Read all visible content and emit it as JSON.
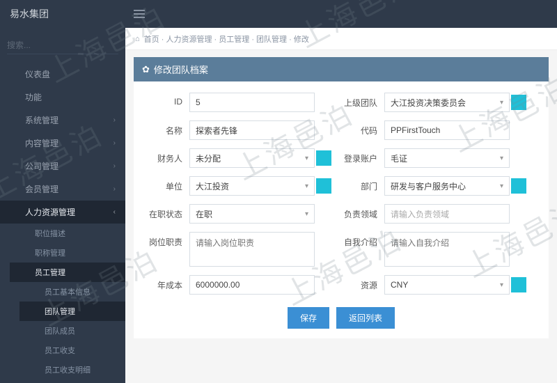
{
  "brand": "易水集团",
  "search_placeholder": "搜索...",
  "sidebar": [
    {
      "label": "仪表盘",
      "icon": "home"
    },
    {
      "label": "功能",
      "icon": "globe"
    },
    {
      "label": "系统管理",
      "icon": "sliders",
      "chev": true
    },
    {
      "label": "内容管理",
      "icon": "layers",
      "chev": true
    },
    {
      "label": "公司管理",
      "icon": "building",
      "chev": true
    },
    {
      "label": "会员管理",
      "icon": "trophy",
      "chev": true
    },
    {
      "label": "人力资源管理",
      "icon": "users",
      "chev": true,
      "active": true,
      "children": [
        {
          "label": "职位描述",
          "icon": "link"
        },
        {
          "label": "职称管理",
          "icon": "link"
        },
        {
          "label": "员工管理",
          "icon": "person",
          "active": true,
          "children": [
            {
              "label": "员工基本信息",
              "icon": "person"
            },
            {
              "label": "团队管理",
              "icon": "users",
              "active": true
            },
            {
              "label": "团队成员",
              "icon": "person"
            },
            {
              "label": "员工收支",
              "icon": "wallet"
            },
            {
              "label": "员工收支明细",
              "icon": "list"
            }
          ]
        }
      ]
    }
  ],
  "breadcrumb": [
    "首页",
    "人力资源管理",
    "员工管理",
    "团队管理",
    "修改"
  ],
  "panel_title": "修改团队档案",
  "form": {
    "id_label": "ID",
    "id_value": "5",
    "parent_label": "上级团队",
    "parent_value": "大江投资决策委员会",
    "name_label": "名称",
    "name_value": "探索者先锋",
    "code_label": "代码",
    "code_value": "PPFirstTouch",
    "finance_label": "财务人",
    "finance_value": "未分配",
    "login_label": "登录账户",
    "login_value": "毛证",
    "unit_label": "单位",
    "unit_value": "大江投资",
    "dept_label": "部门",
    "dept_value": "研发与客户服务中心",
    "status_label": "在职状态",
    "status_value": "在职",
    "domain_label": "负责领域",
    "domain_placeholder": "请输入负责领域",
    "duty_label": "岗位职责",
    "duty_placeholder": "请输入岗位职责",
    "intro_label": "自我介绍",
    "intro_placeholder": "请输入自我介绍",
    "cost_label": "年成本",
    "cost_value": "6000000.00",
    "currency_label": "资源",
    "currency_value": "CNY"
  },
  "buttons": {
    "save": "保存",
    "back": "返回列表"
  },
  "watermark": "上海邑泊"
}
